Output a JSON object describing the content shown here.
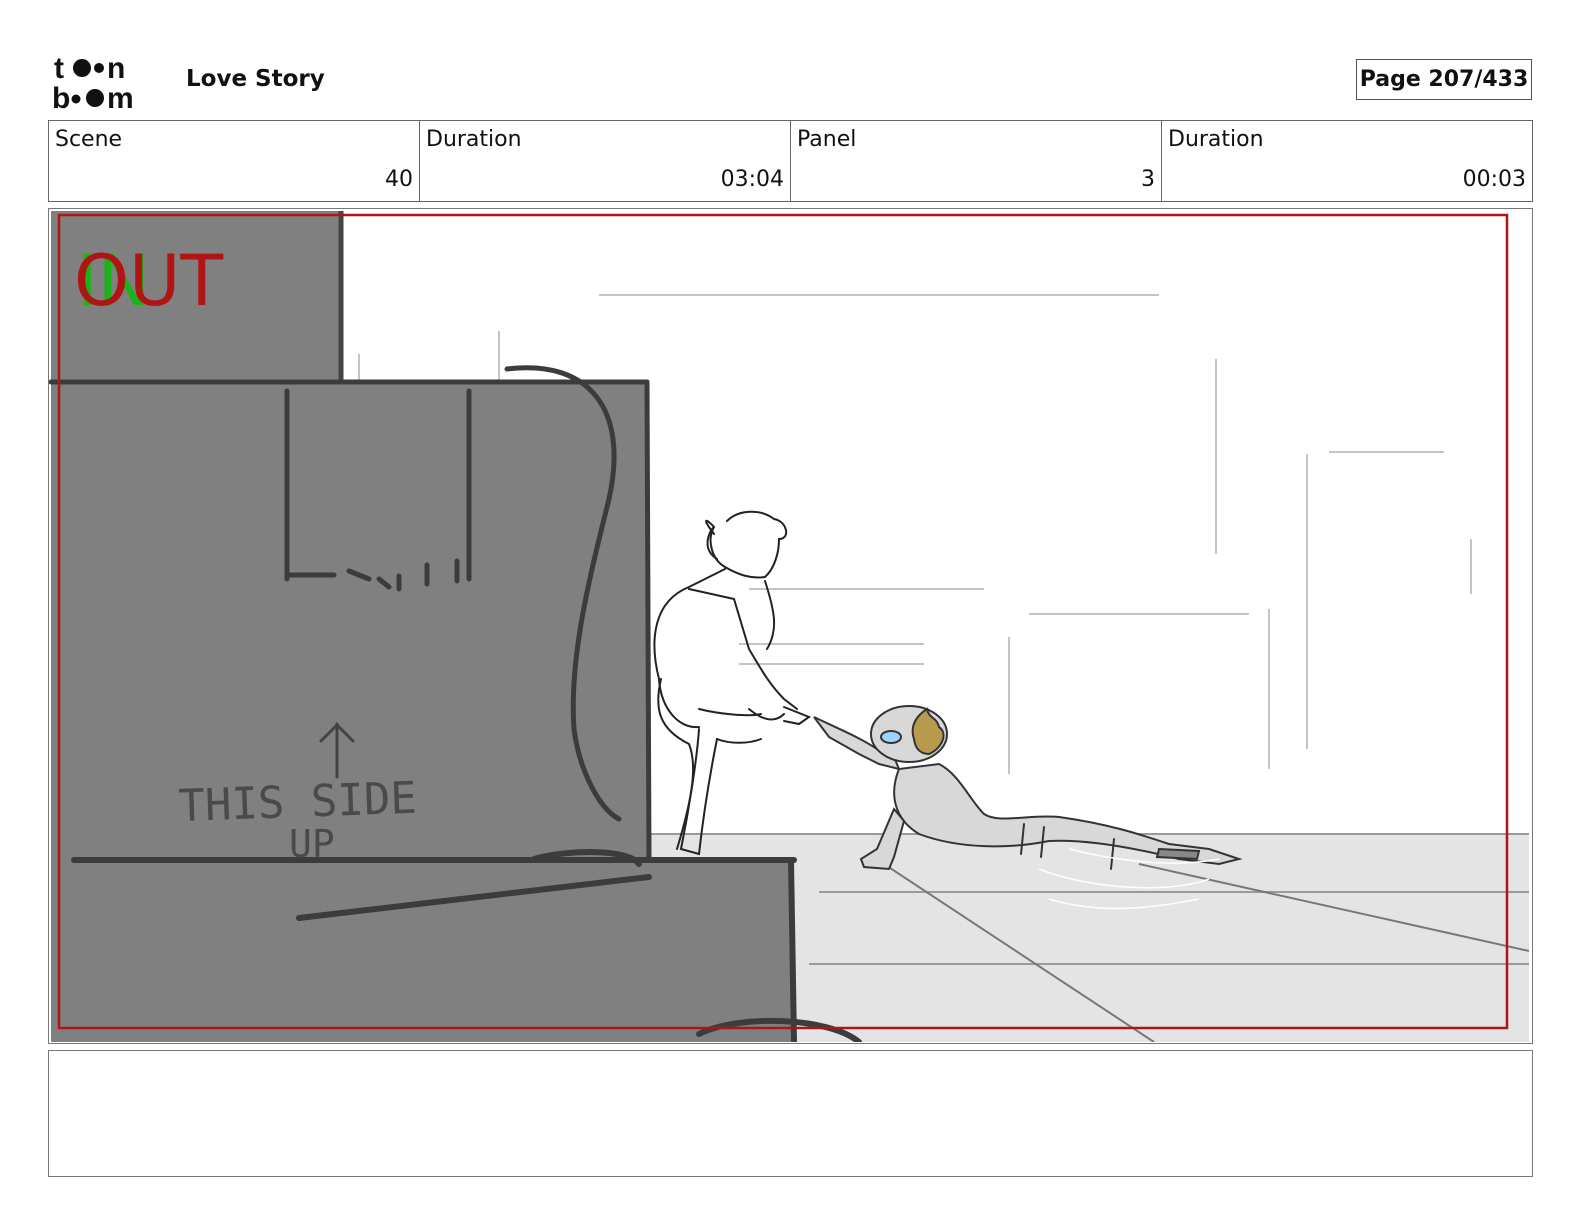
{
  "header": {
    "logo_text": "toon boom",
    "project_title": "Love Story",
    "page_label": "Page 207/433"
  },
  "info": {
    "scene_label": "Scene",
    "scene_value": "40",
    "scene_duration_label": "Duration",
    "scene_duration_value": "03:04",
    "panel_label": "Panel",
    "panel_value": "3",
    "panel_duration_label": "Duration",
    "panel_duration_value": "00:03"
  },
  "panel": {
    "in_marker": "IN",
    "out_marker": "OUT",
    "box_text_line1": "THIS SIDE",
    "box_text_line2": "UP",
    "safe_frame_color": "#b01515",
    "in_color": "#18b418",
    "out_color": "#b01515"
  },
  "notes": {
    "text": ""
  }
}
